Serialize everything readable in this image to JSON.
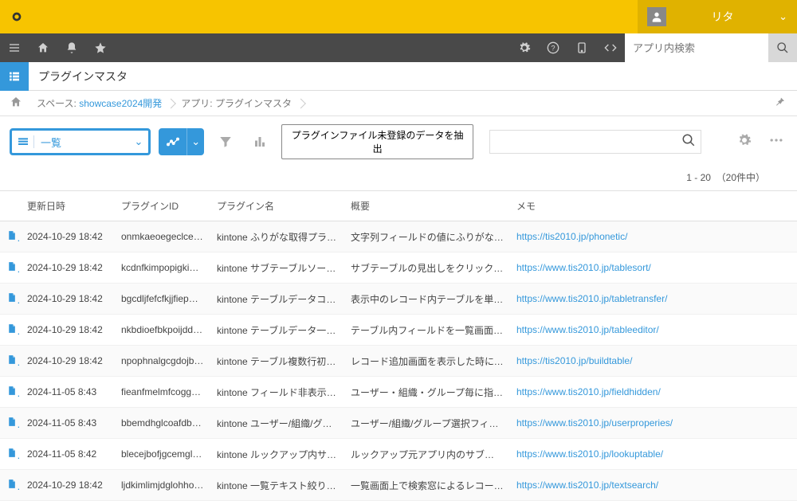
{
  "user": {
    "name": "リタ"
  },
  "search": {
    "placeholder": "アプリ内検索"
  },
  "app": {
    "title": "プラグインマスタ"
  },
  "breadcrumb": {
    "space_prefix": "スペース: ",
    "space_link": "showcase2024開発",
    "app_prefix": "アプリ: ",
    "app_name": "プラグインマスタ"
  },
  "view": {
    "label": "一覧"
  },
  "filter_button": "プラグインファイル未登録のデータを抽出",
  "pagination": {
    "range": "1 - 20",
    "total": "（20件中）"
  },
  "columns": {
    "date": "更新日時",
    "plugin_id": "プラグインID",
    "plugin_name": "プラグイン名",
    "summary": "概要",
    "memo": "メモ"
  },
  "rows": [
    {
      "date": "2024-10-29 18:42",
      "pid": "onmkaeoegeclcekfbcjkdghebfjjeodn",
      "pname": "kintone ふりがな取得プラグイン",
      "summary": "文字列フィールドの値にふりがなを振るプラグイン",
      "memo": "https://tis2010.jp/phonetic/"
    },
    {
      "date": "2024-10-29 18:42",
      "pid": "kcdnfkimpopigkionojhgfepdlcmdabc",
      "pname": "kintone サブテーブルソートプラグイン",
      "summary": "サブテーブルの見出しをクリックするとソートできる",
      "memo": "https://www.tis2010.jp/tablesort/"
    },
    {
      "date": "2024-10-29 18:42",
      "pid": "bgcdljfefcfkjjfiepmcabcdefghijkl",
      "pname": "kintone テーブルデータコピープラグイン",
      "summary": "表示中のレコード内テーブルを単一レコードへコピー",
      "memo": "https://www.tis2010.jp/tabletransfer/"
    },
    {
      "date": "2024-10-29 18:42",
      "pid": "nkbdioefbkpoijddjmnopqrstuvwxabc",
      "pname": "kintone テーブルデータ一括編集プラグイン",
      "summary": "テーブル内フィールドを一覧画面上で編集",
      "memo": "https://www.tis2010.jp/tableeditor/"
    },
    {
      "date": "2024-10-29 18:42",
      "pid": "npophnalgcgdojbeleabcdefghijklmn",
      "pname": "kintone テーブル複数行初期表示プラグイン",
      "summary": "レコード追加画面を表示した時に、決められた行数を表示",
      "memo": "https://tis2010.jp/buildtable/"
    },
    {
      "date": "2024-11-05 8:43",
      "pid": "fieanfmelmfcoggmlabcdefghijklmno",
      "pname": "kintone フィールド非表示プラグイン",
      "summary": "ユーザー・組織・グループ毎に指定フィールドを非表示",
      "memo": "https://www.tis2010.jp/fieldhidden/"
    },
    {
      "date": "2024-11-05 8:43",
      "pid": "bbemdhglcoafdbbmnopqrstuvwxyzabc",
      "pname": "kintone ユーザー/組織/グループ選択プラグイン",
      "summary": "ユーザー/組織/グループ選択フィールドを拡張",
      "memo": "https://www.tis2010.jp/userproperies/"
    },
    {
      "date": "2024-11-05 8:42",
      "pid": "blecejbofjgcemglmnopqrstuvwxyzab",
      "pname": "kintone ルックアップ内サブテーブルプラグイン",
      "summary": "ルックアップ元アプリ内のサブテーブルを取得",
      "memo": "https://www.tis2010.jp/lookuptable/"
    },
    {
      "date": "2024-10-29 18:42",
      "pid": "ljdkimlimjdglohhoopqrstuvwxyzabc",
      "pname": "kintone 一覧テキスト絞り込みプラグイン",
      "summary": "一覧画面上で検索窓によるレコードの絞り込み",
      "memo": "https://www.tis2010.jp/textsearch/"
    }
  ]
}
